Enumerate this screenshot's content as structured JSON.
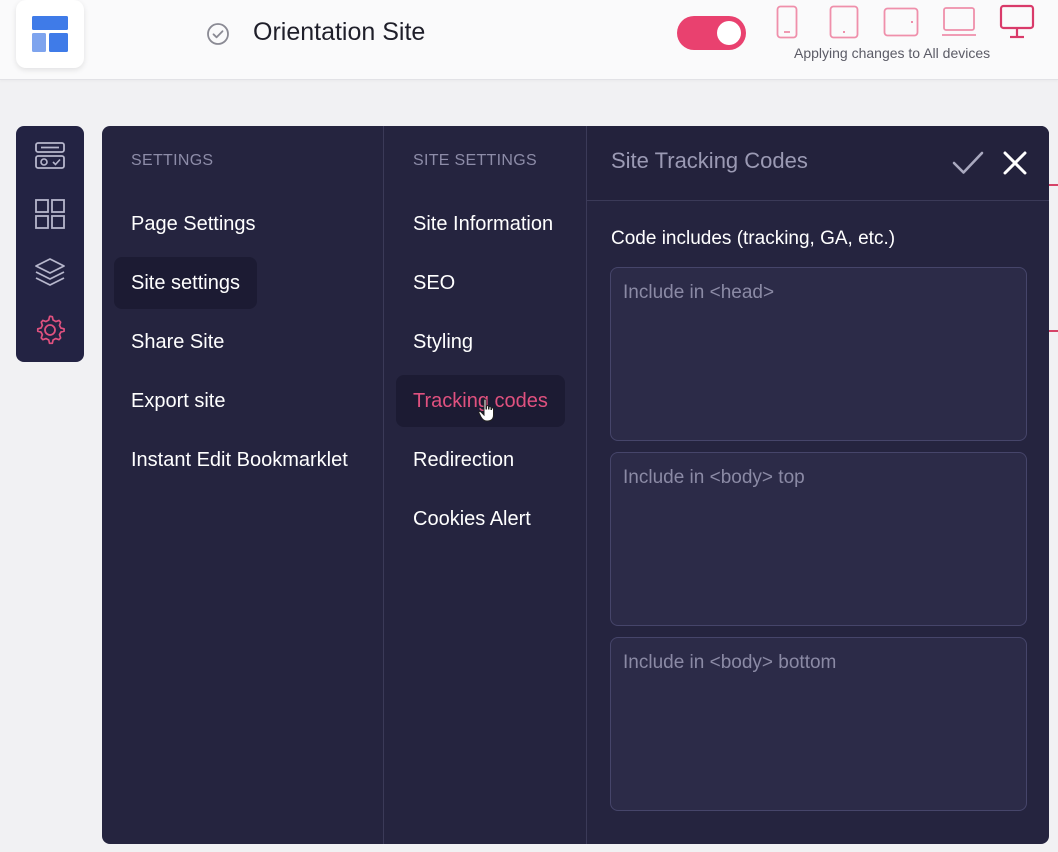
{
  "header": {
    "site_title": "Orientation Site",
    "apply_text": "Applying changes to All devices",
    "toggle_on": true,
    "devices": [
      "mobile-portrait",
      "tablet-portrait",
      "tablet-landscape",
      "laptop",
      "desktop"
    ],
    "active_device": "desktop"
  },
  "rail": {
    "icons": [
      "widgets-icon",
      "grid-icon",
      "layers-icon",
      "settings-icon"
    ],
    "active": "settings-icon"
  },
  "settings_column": {
    "heading": "SETTINGS",
    "items": [
      {
        "label": "Page Settings"
      },
      {
        "label": "Site settings"
      },
      {
        "label": "Share Site"
      },
      {
        "label": "Export site"
      },
      {
        "label": "Instant Edit Bookmarklet"
      }
    ],
    "selected": "Site settings"
  },
  "site_settings_column": {
    "heading": "SITE SETTINGS",
    "items": [
      {
        "label": "Site Information"
      },
      {
        "label": "SEO"
      },
      {
        "label": "Styling"
      },
      {
        "label": "Tracking codes"
      },
      {
        "label": "Redirection"
      },
      {
        "label": "Cookies Alert"
      }
    ],
    "selected": "Tracking codes"
  },
  "tracking_panel": {
    "title": "Site Tracking Codes",
    "field_label": "Code includes (tracking, GA, etc.)",
    "head_placeholder": "Include in <head>",
    "body_top_placeholder": "Include in <body> top",
    "body_bottom_placeholder": "Include in <body> bottom",
    "head_value": "",
    "body_top_value": "",
    "body_bottom_value": ""
  },
  "colors": {
    "accent_pink": "#e9416f",
    "panel_bg": "#25243f",
    "rail_bg": "#232343",
    "logo_blue": "#3f7be8"
  }
}
